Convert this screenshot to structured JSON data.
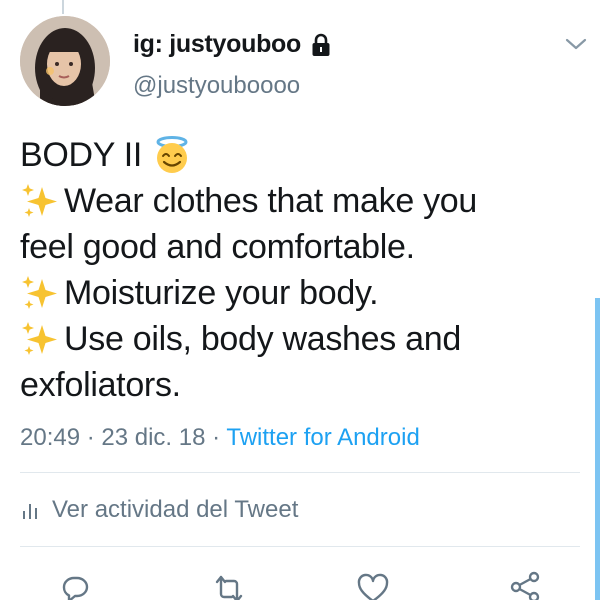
{
  "header": {
    "display_name": "ig: justyouboo",
    "handle": "@justyouboooo"
  },
  "tweet": {
    "line1": "BODY II",
    "line2": "Wear clothes that make you",
    "line3": "feel good and comfortable.",
    "line4": "Moisturize your body.",
    "line5": "Use oils, body washes and",
    "line6": "exfoliators."
  },
  "meta": {
    "time": "20:49",
    "separator1": " · ",
    "date": "23 dic. 18",
    "separator2": " · ",
    "source": "Twitter for Android"
  },
  "activity": {
    "label": "Ver actividad del Tweet"
  },
  "icons": {
    "avatar": "profile-photo",
    "lock": "lock-icon",
    "chevron": "chevron-down-icon",
    "halo": "smiling-face-with-halo-emoji",
    "sparkles": "sparkles-emoji",
    "activity": "bar-chart-icon",
    "reply": "reply-icon",
    "retweet": "retweet-icon",
    "like": "heart-icon",
    "share": "share-icon"
  },
  "colors": {
    "text": "#14171a",
    "secondary": "#657786",
    "link": "#1da1f2",
    "sparkle": "#f7c331"
  }
}
